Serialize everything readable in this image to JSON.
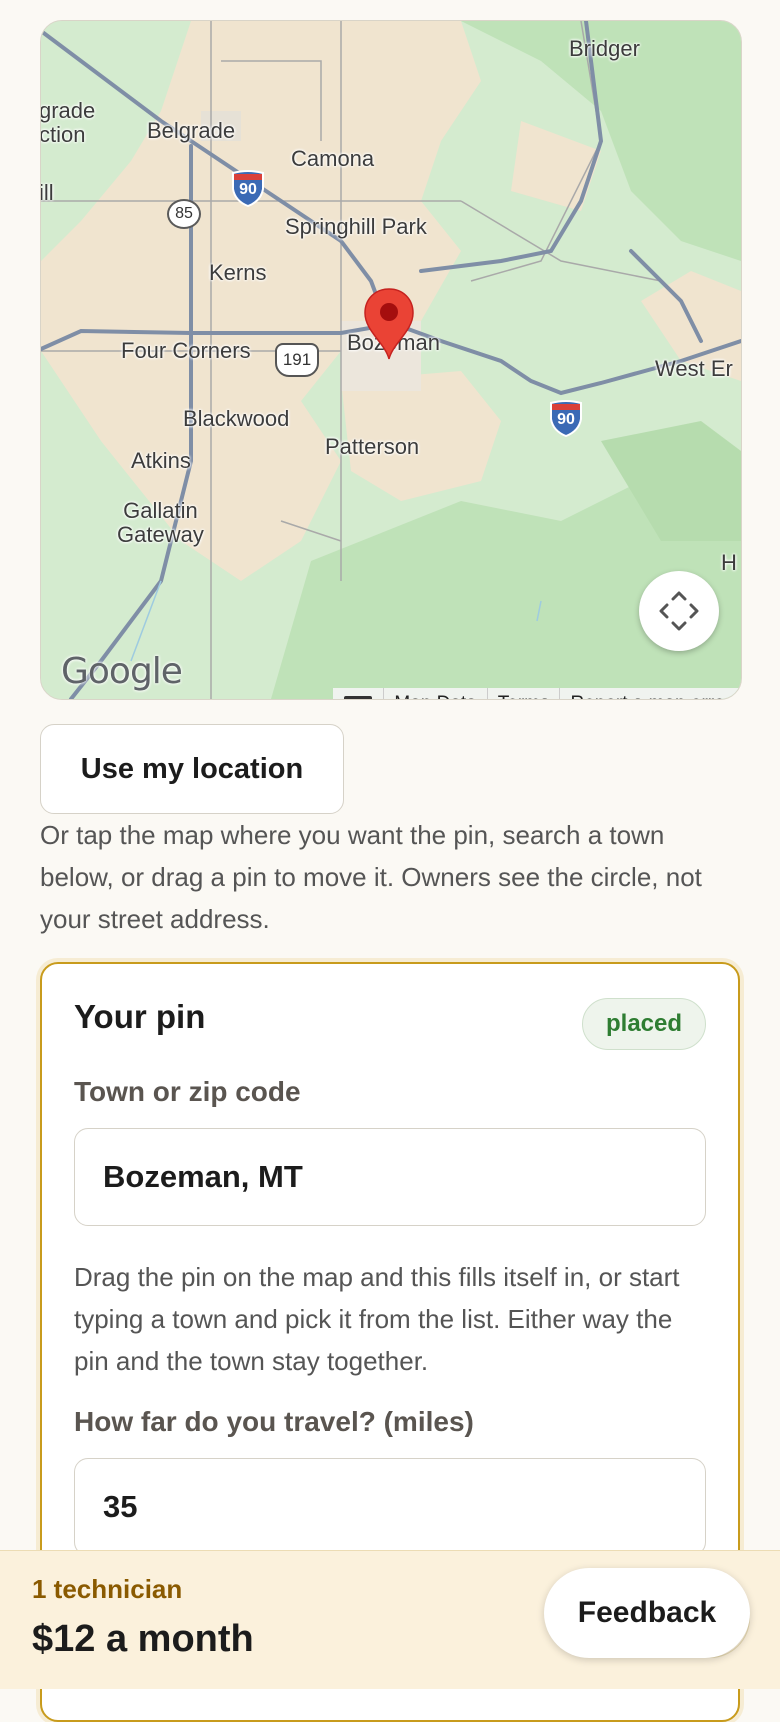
{
  "map": {
    "labels": {
      "bridger": "Bridger",
      "belgrade_junction": "grade\nction",
      "belgrade": "Belgrade",
      "camona": "Camona",
      "hill": "ill",
      "springhill_park": "Springhill Park",
      "kerns": "Kerns",
      "four_corners": "Four Corners",
      "bozeman": "Bozeman",
      "west_end": "West Er",
      "blackwood": "Blackwood",
      "patterson": "Patterson",
      "atkins": "Atkins",
      "gallatin_gateway": "Gallatin\nGateway",
      "h_edge": "H"
    },
    "shields": {
      "interstate_1": "90",
      "interstate_2": "90",
      "route_85": "85",
      "us_191": "191"
    },
    "logo": "Google",
    "attribution": {
      "map_data": "Map Data",
      "terms": "Terms",
      "report": "Report a map error"
    },
    "icons": {
      "pin": "map-pin-icon",
      "recenter": "recenter-arrows-icon",
      "keyboard": "keyboard-icon"
    }
  },
  "location": {
    "use_my_location": "Use my location",
    "hint": "Or tap the map where you want the pin, search a town below, or drag a pin to move it. Owners see the circle, not your street address."
  },
  "pin_card": {
    "title": "Your pin",
    "status": "placed",
    "town_label": "Town or zip code",
    "town_value": "Bozeman, MT",
    "town_help": "Drag the pin on the map and this fills itself in, or start typing a town and pick it from the list. Either way the pin and the town stay together.",
    "distance_label": "How far do you travel? (miles)",
    "distance_value": "35"
  },
  "summary": {
    "technicians": "1 technician",
    "price": "$12 a month"
  },
  "feedback_label": "Feedback",
  "colors": {
    "accent_border": "#c89b1c",
    "status_green": "#2e7d32",
    "tech_count": "#8a5a00",
    "pin_red": "#ea4335"
  }
}
